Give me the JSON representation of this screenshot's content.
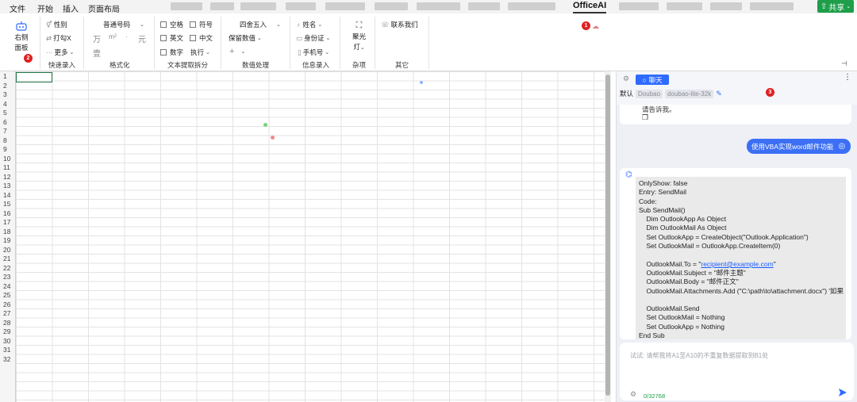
{
  "menu": {
    "items": [
      "文件",
      "开始",
      "插入",
      "页面布局"
    ],
    "officeai": "OfficeAI",
    "share": "共享"
  },
  "ribbon": {
    "panel_button": {
      "line1": "右侧",
      "line2": "面板"
    },
    "quick_entry": {
      "gender": "性别",
      "check_x": "打勾X",
      "more": "更多",
      "label": "快速录入"
    },
    "format": {
      "number_type": "普通号码",
      "wan": "万",
      "sq": "m²",
      "dot": "·",
      "yuan": "元",
      "yi": "壹",
      "label": "格式化"
    },
    "text_extract": {
      "space": "空格",
      "symbol": "符号",
      "english": "英文",
      "chinese": "中文",
      "number": "数字",
      "execute": "执行",
      "label": "文本提取拆分"
    },
    "number_proc": {
      "round": "四舍五入",
      "keep": "保留数值",
      "plus": "+",
      "label": "数值处理"
    },
    "info_entry": {
      "name": "姓名",
      "id_card": "身份证",
      "phone": "手机号",
      "label": "信息录入"
    },
    "misc": {
      "spotlight1": "聚光",
      "spotlight2": "灯",
      "label": "杂项"
    },
    "other": {
      "contact": "联系我们",
      "label": "其它"
    },
    "badges": {
      "b1": "1",
      "b2": "2",
      "b3": "3"
    }
  },
  "sheet": {
    "rows": [
      "1",
      "2",
      "3",
      "4",
      "5",
      "6",
      "7",
      "8",
      "9",
      "10",
      "11",
      "12",
      "13",
      "14",
      "15",
      "16",
      "17",
      "18",
      "19",
      "20",
      "21",
      "22",
      "23",
      "24",
      "25",
      "26",
      "27",
      "28",
      "29",
      "30",
      "31",
      "32"
    ]
  },
  "panel": {
    "tab_chat": "聊天",
    "default_label": "默认",
    "model_provider": "Doubao",
    "model_name": "doubao-lite-32k",
    "prev_msg_tail": "请告诉我。",
    "user_msg": "使用VBA实现word邮件功能",
    "code_lines": [
      "OnlyShow: false",
      "Entry: SendMail",
      "Code:",
      "Sub SendMail()",
      "    Dim OutlookApp As Object",
      "    Dim OutlookMail As Object",
      "    Set OutlookApp = CreateObject(\"Outlook.Application\")",
      "    Set OutlookMail = OutlookApp.CreateItem(0)",
      "",
      "    OutlookMail.To = \"",
      "    OutlookMail.Subject = \"邮件主题\"",
      "    OutlookMail.Body = \"邮件正文\"",
      "    OutlookMail.Attachments.Add (\"C:\\path\\to\\attachment.docx\") '如果",
      "",
      "    OutlookMail.Send",
      "    Set OutlookMail = Nothing",
      "    Set OutlookApp = Nothing",
      "End Sub"
    ],
    "email_link": "recipient@example.com",
    "email_tail": "\"",
    "input_placeholder": "试试: 请帮我将A1至A10的不重复数据提取到B1处",
    "char_count": "0/32768"
  },
  "colors": {
    "accent": "#2f6bff",
    "share": "#1e9e49",
    "badge": "#e02020",
    "selection": "#217346"
  }
}
